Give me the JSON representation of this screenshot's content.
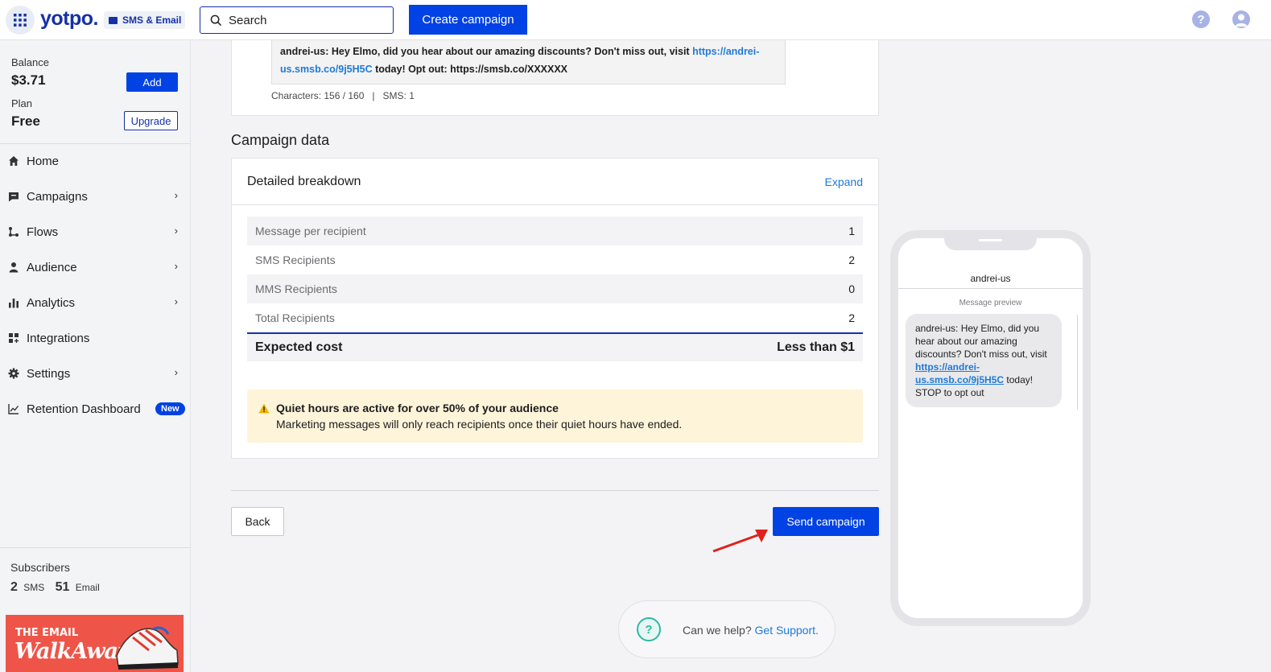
{
  "header": {
    "logo": "yotpo.",
    "product": "SMS & Email",
    "search_placeholder": "Search",
    "create_campaign": "Create campaign",
    "help": "?"
  },
  "sidebar": {
    "balance_label": "Balance",
    "balance_value": "$3.71",
    "add_label": "Add",
    "plan_label": "Plan",
    "plan_value": "Free",
    "upgrade_label": "Upgrade",
    "items": [
      {
        "label": "Home",
        "icon": "home-icon",
        "chevron": false
      },
      {
        "label": "Campaigns",
        "icon": "campaigns-icon",
        "chevron": true
      },
      {
        "label": "Flows",
        "icon": "flows-icon",
        "chevron": true
      },
      {
        "label": "Audience",
        "icon": "person-icon",
        "chevron": true
      },
      {
        "label": "Analytics",
        "icon": "bar-chart-icon",
        "chevron": true
      },
      {
        "label": "Integrations",
        "icon": "integrations-icon",
        "chevron": false
      },
      {
        "label": "Settings",
        "icon": "gear-icon",
        "chevron": true
      },
      {
        "label": "Retention Dashboard",
        "icon": "trend-icon",
        "chevron": false,
        "badge": "New"
      }
    ],
    "subscribers_label": "Subscribers",
    "sms_count": "2",
    "sms_label": "SMS",
    "email_count": "51",
    "email_label": "Email",
    "banner_line1": "THE EMAIL",
    "banner_line2": "WalkAway"
  },
  "message": {
    "text_prefix": "andrei-us: Hey Elmo, did you hear about our amazing discounts? Don't miss out, visit ",
    "link_part1": "https://andrei-",
    "link_part2": "us.smsb.co/9j5H5C",
    "text_suffix": " today! Opt out: https://smsb.co/XXXXXX",
    "char_count": "Characters: 156 / 160   |   SMS: 1"
  },
  "campaign_data": {
    "section_title": "Campaign data",
    "card_title": "Detailed breakdown",
    "expand": "Expand",
    "rows": [
      {
        "label": "Message per recipient",
        "value": "1"
      },
      {
        "label": "SMS Recipients",
        "value": "2"
      },
      {
        "label": "MMS Recipients",
        "value": "0"
      },
      {
        "label": "Total Recipients",
        "value": "2"
      }
    ],
    "expected_label": "Expected cost",
    "expected_value": "Less than $1",
    "warning_title": "Quiet hours are active for over 50% of your audience",
    "warning_body": "Marketing messages will only reach recipients once their quiet hours have ended."
  },
  "actions": {
    "back": "Back",
    "send": "Send campaign"
  },
  "support": {
    "text": "Can we help?",
    "link": "Get Support."
  },
  "phone": {
    "sender": "andrei-us",
    "preview_label": "Message preview",
    "bubble_prefix": "andrei-us: Hey Elmo, did you hear about our amazing discounts? Don't miss out, visit ",
    "bubble_link": "https://andrei-us.smsb.co/9j5H5C",
    "bubble_suffix": " today! STOP to opt out"
  },
  "colors": {
    "primary": "#0042e4",
    "brand": "#1531a8",
    "link": "#1f7ad6",
    "warning_bg": "#fdf4d9"
  }
}
